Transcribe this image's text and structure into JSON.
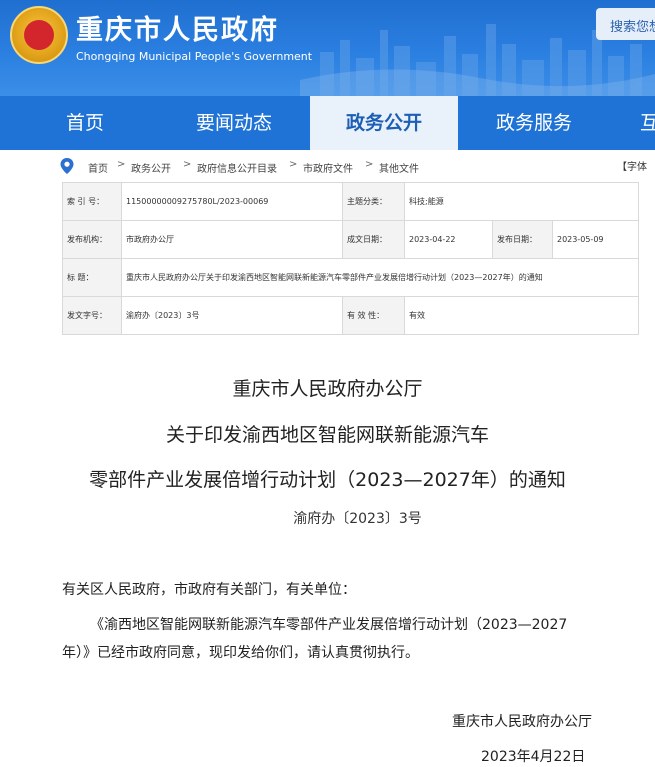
{
  "header": {
    "title": "重庆市人民政府",
    "subtitle": "Chongqing Municipal People's Government",
    "search_label": "搜索您想"
  },
  "nav": {
    "items": [
      {
        "label": "首页"
      },
      {
        "label": "要闻动态"
      },
      {
        "label": "政务公开",
        "active": true
      },
      {
        "label": "政务服务"
      },
      {
        "label": "互"
      }
    ]
  },
  "breadcrumb": {
    "items": [
      "首页",
      "政务公开",
      "政府信息公开目录",
      "市政府文件",
      "其他文件"
    ],
    "font_control": "【字体"
  },
  "info": {
    "index_label": "索  引  号：",
    "index_value": "11500000009275780L/2023-00069",
    "category_label": "主题分类：",
    "category_value": "科技;能源",
    "issuer_label": "发布机构：",
    "issuer_value": "市政府办公厅",
    "written_date_label": "成文日期：",
    "written_date_value": "2023-04-22",
    "publish_date_label": "发布日期：",
    "publish_date_value": "2023-05-09",
    "title_label": "标      题：",
    "title_value": "重庆市人民政府办公厅关于印发渝西地区智能网联新能源汽车零部件产业发展倍增行动计划（2023—2027年）的通知",
    "doc_no_label": "发文字号：",
    "doc_no_value": "渝府办〔2023〕3号",
    "validity_label": "有  效  性：",
    "validity_value": "有效"
  },
  "document": {
    "title_line1": "重庆市人民政府办公厅",
    "title_line2": "关于印发渝西地区智能网联新能源汽车",
    "title_line3": "零部件产业发展倍增行动计划（2023—2027年）的通知",
    "doc_number": "渝府办〔2023〕3号",
    "salutation": "有关区人民政府，市政府有关部门，有关单位：",
    "body_line1": "《渝西地区智能网联新能源汽车零部件产业发展倍增行动计划（2023—2027",
    "body_line2": "年）》已经市政府同意，现印发给你们，请认真贯彻执行。",
    "signature": "重庆市人民政府办公厅",
    "date": "2023年4月22日"
  },
  "colors": {
    "header_blue": "#1f6fd0",
    "nav_blue": "#1f73d6",
    "nav_active_bg": "#e9f1fb",
    "nav_active_text": "#1d5fb5",
    "pin_blue": "#2b6fd0"
  }
}
